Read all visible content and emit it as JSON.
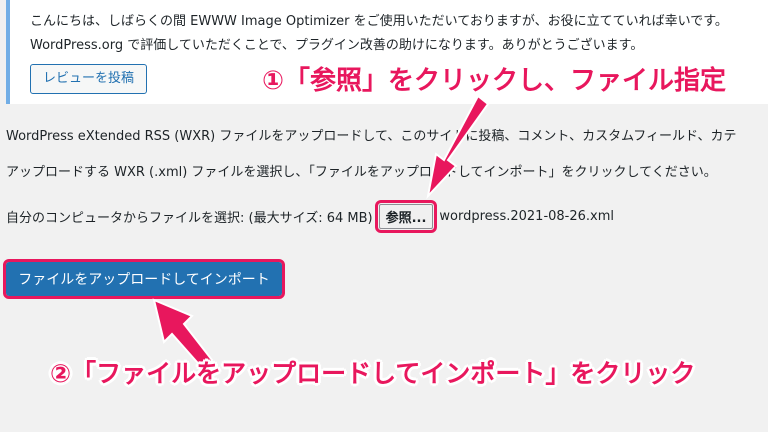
{
  "notice": {
    "line1": "こんにちは、しばらくの間 EWWW Image Optimizer をご使用いただいておりますが、お役に立てていれば幸いです。",
    "line2": "WordPress.org で評価していただくことで、プラグイン改善の助けになります。ありがとうございます。",
    "review_button": "レビューを投稿"
  },
  "importer": {
    "description": "WordPress eXtended RSS (WXR) ファイルをアップロードして、このサイトに投稿、コメント、カスタムフィールド、カテ",
    "instruction": "アップロードする WXR (.xml) ファイルを選択し、「ファイルをアップロードしてインポート」をクリックしてください。",
    "file_label": "自分のコンピュータからファイルを選択: (最大サイズ: 64 MB)",
    "browse_button": "参照...",
    "file_name": "wordpress.2021-08-26.xml",
    "submit_button": "ファイルをアップロードしてインポート"
  },
  "annotations": {
    "step1": "①「参照」をクリックし、ファイル指定",
    "step2": "②「ファイルをアップロードしてインポート」をクリック",
    "highlight_color": "#e8175d"
  }
}
